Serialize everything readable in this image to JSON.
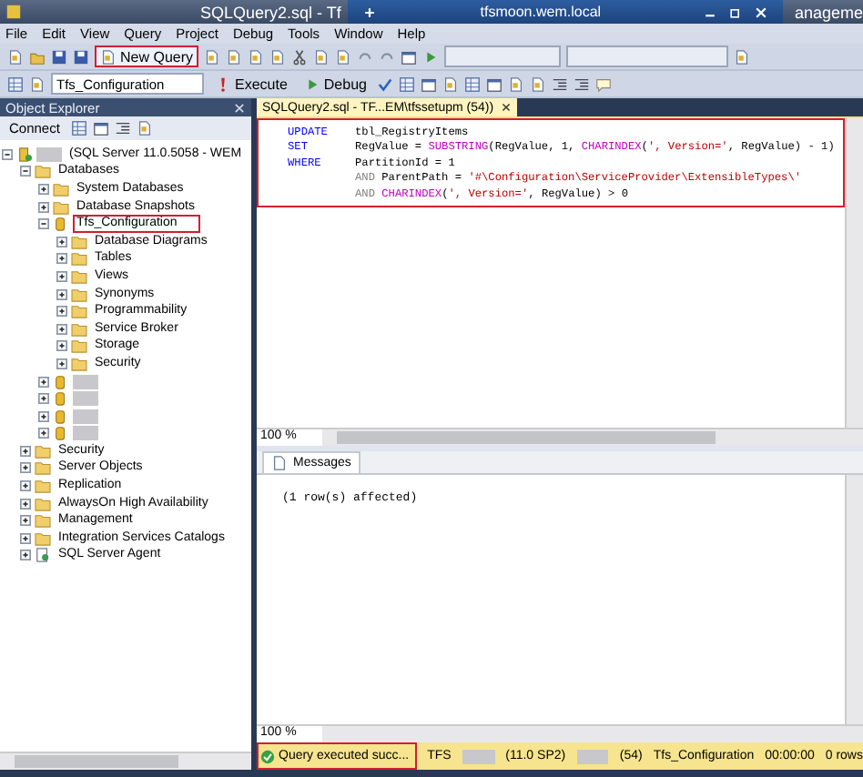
{
  "window": {
    "title": "SQLQuery2.sql - Tf",
    "title_right": "anageme"
  },
  "remote_bar": {
    "host": "tfsmoon.wem.local"
  },
  "menu": [
    "File",
    "Edit",
    "View",
    "Query",
    "Project",
    "Debug",
    "Tools",
    "Window",
    "Help"
  ],
  "toolbar": {
    "new_query": {
      "label": "New Query",
      "highlighted": true
    }
  },
  "query_toolbar": {
    "database": "Tfs_Configuration",
    "execute": "Execute",
    "debug": "Debug"
  },
  "object_explorer": {
    "title": "Object Explorer",
    "connect": "Connect",
    "tree": [
      {
        "kind": "server",
        "label": "(SQL Server 11.0.5058 - WEM",
        "name_hidden": true,
        "expanded": true,
        "children": [
          {
            "kind": "folder",
            "label": "Databases",
            "expanded": true,
            "children": [
              {
                "kind": "folder",
                "label": "System Databases",
                "expanded": false
              },
              {
                "kind": "folder",
                "label": "Database Snapshots",
                "expanded": false
              },
              {
                "kind": "database",
                "label": "Tfs_Configuration",
                "expanded": true,
                "highlighted": true,
                "children": [
                  {
                    "kind": "folder",
                    "label": "Database Diagrams",
                    "expanded": false
                  },
                  {
                    "kind": "folder",
                    "label": "Tables",
                    "expanded": false
                  },
                  {
                    "kind": "folder",
                    "label": "Views",
                    "expanded": false
                  },
                  {
                    "kind": "folder",
                    "label": "Synonyms",
                    "expanded": false
                  },
                  {
                    "kind": "folder",
                    "label": "Programmability",
                    "expanded": false
                  },
                  {
                    "kind": "folder",
                    "label": "Service Broker",
                    "expanded": false
                  },
                  {
                    "kind": "folder",
                    "label": "Storage",
                    "expanded": false
                  },
                  {
                    "kind": "folder",
                    "label": "Security",
                    "expanded": false
                  }
                ]
              },
              {
                "kind": "database",
                "name_hidden": true,
                "expanded": false
              },
              {
                "kind": "database",
                "name_hidden": true,
                "expanded": false
              },
              {
                "kind": "database",
                "name_hidden": true,
                "expanded": false
              },
              {
                "kind": "database",
                "name_hidden": true,
                "expanded": false
              }
            ]
          },
          {
            "kind": "folder",
            "label": "Security",
            "expanded": false
          },
          {
            "kind": "folder",
            "label": "Server Objects",
            "expanded": false
          },
          {
            "kind": "folder",
            "label": "Replication",
            "expanded": false
          },
          {
            "kind": "folder",
            "label": "AlwaysOn High Availability",
            "expanded": false
          },
          {
            "kind": "folder",
            "label": "Management",
            "expanded": false
          },
          {
            "kind": "folder",
            "label": "Integration Services Catalogs",
            "expanded": false
          },
          {
            "kind": "agent",
            "label": "SQL Server Agent",
            "expanded": false
          }
        ]
      }
    ]
  },
  "editor": {
    "tab": "SQLQuery2.sql - TF...EM\\tfssetupm (54))",
    "highlighted": true,
    "lines": [
      {
        "keyword": "UPDATE",
        "tokens": [
          {
            "kind": "plain",
            "text": "tbl_RegistryItems"
          }
        ]
      },
      {
        "keyword": "SET",
        "tokens": [
          {
            "kind": "plain",
            "text": "RegValue = "
          },
          {
            "kind": "function",
            "text": "SUBSTRING"
          },
          {
            "kind": "plain",
            "text": "(RegValue, 1, "
          },
          {
            "kind": "function",
            "text": "CHARINDEX"
          },
          {
            "kind": "plain",
            "text": "("
          },
          {
            "kind": "string",
            "text": "', Version='"
          },
          {
            "kind": "plain",
            "text": ", RegValue) - 1)"
          }
        ]
      },
      {
        "keyword": "WHERE",
        "tokens": [
          {
            "kind": "plain",
            "text": "PartitionId = 1"
          }
        ]
      },
      {
        "tokens": [
          {
            "kind": "operator",
            "text": "AND"
          },
          {
            "kind": "plain",
            "text": "ParentPath = "
          },
          {
            "kind": "string",
            "text": "'#\\Configuration\\ServiceProvider\\ExtensibleTypes\\'"
          }
        ]
      },
      {
        "tokens": [
          {
            "kind": "operator",
            "text": "AND"
          },
          {
            "kind": "function",
            "text": "CHARINDEX"
          },
          {
            "kind": "plain",
            "text": "("
          },
          {
            "kind": "string",
            "text": "', Version='"
          },
          {
            "kind": "plain",
            "text": ", RegValue) > 0"
          }
        ]
      }
    ],
    "zoom": "100 %"
  },
  "results": {
    "tab": "Messages",
    "message": "(1 row(s) affected)",
    "zoom": "100 %"
  },
  "status_bar": {
    "highlighted": true,
    "items": [
      {
        "kind": "success",
        "text": "Query executed succ..."
      },
      {
        "kind": "text",
        "text": "TFS"
      },
      {
        "kind": "redacted"
      },
      {
        "kind": "text",
        "text": "(11.0 SP2)"
      },
      {
        "kind": "redacted"
      },
      {
        "kind": "text",
        "text": "(54)"
      },
      {
        "kind": "text",
        "text": "Tfs_Configuration"
      },
      {
        "kind": "text",
        "text": "00:00:00"
      },
      {
        "kind": "text",
        "text": "0 rows"
      }
    ]
  }
}
